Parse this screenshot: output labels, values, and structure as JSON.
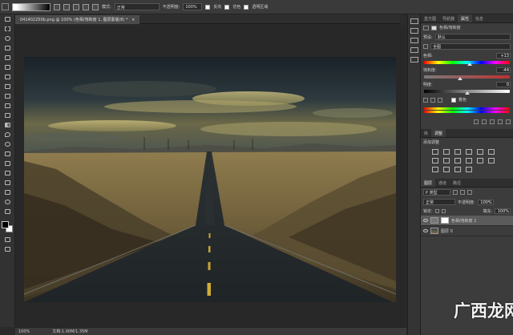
{
  "options_bar": {
    "mode_label": "模式:",
    "mode_value": "正常",
    "opacity_label": "不透明度:",
    "opacity_value": "100%",
    "reverse_label": "反向",
    "dither_label": "仿色",
    "transparency_label": "透明区域"
  },
  "document_tab": {
    "title": "041402250b.png @ 100% (色相/饱和度 1, 图层蒙版/8) *",
    "close": "×"
  },
  "status_bar": {
    "zoom": "100%",
    "doc_info": "文档:1.00M/1.35M"
  },
  "properties_panel": {
    "tabs": [
      "直方图",
      "导航器",
      "属性",
      "信息"
    ],
    "active_tab": "属性",
    "header": "色相/饱和度",
    "preset_label": "预设:",
    "preset_value": "默认",
    "channel_value": "全图",
    "hue_label": "色相:",
    "hue_value": "+13",
    "saturation_label": "饱和度:",
    "saturation_value": "-44",
    "lightness_label": "明度:",
    "lightness_value": "0",
    "colorize_label": "着色"
  },
  "adjustments_panel": {
    "tabs": [
      "库",
      "调整"
    ],
    "active_tab": "调整",
    "heading": "添加调整"
  },
  "layers_panel": {
    "tabs": [
      "图层",
      "通道",
      "路径"
    ],
    "filter_label": "P 类型",
    "blend_value": "正常",
    "opacity_label": "不透明度:",
    "opacity_value": "100%",
    "lock_label": "锁定:",
    "fill_label": "填充:",
    "fill_value": "100%",
    "layers": [
      {
        "name": "色相/饱和度 1"
      },
      {
        "name": "图层 0"
      }
    ]
  },
  "watermark": {
    "text": "广西龙网"
  },
  "colors": {
    "accent": "#4a8bd6",
    "panel_bg": "#3c3c3c",
    "toolbar_bg": "#323232"
  }
}
